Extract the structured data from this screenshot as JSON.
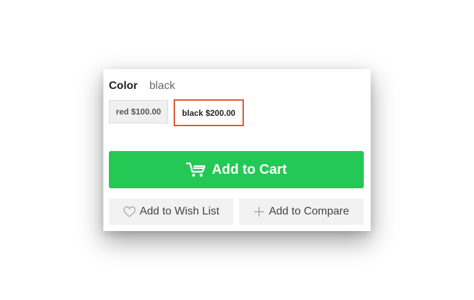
{
  "product_options": {
    "color_label": "Color",
    "color_selected": "black",
    "swatches": [
      {
        "label": "red $100.00",
        "selected": false
      },
      {
        "label": "black $200.00",
        "selected": true
      }
    ]
  },
  "actions": {
    "add_to_cart_label": "Add to Cart",
    "add_to_cart_icon": "cart-icon",
    "wish_list_label": "Add to Wish List",
    "wish_list_icon": "heart-icon",
    "compare_label": "Add to Compare",
    "compare_icon": "plus-icon"
  },
  "colors": {
    "accent_green": "#24c855",
    "selected_border": "#e2542c",
    "secondary_bg": "#f2f2f2"
  }
}
